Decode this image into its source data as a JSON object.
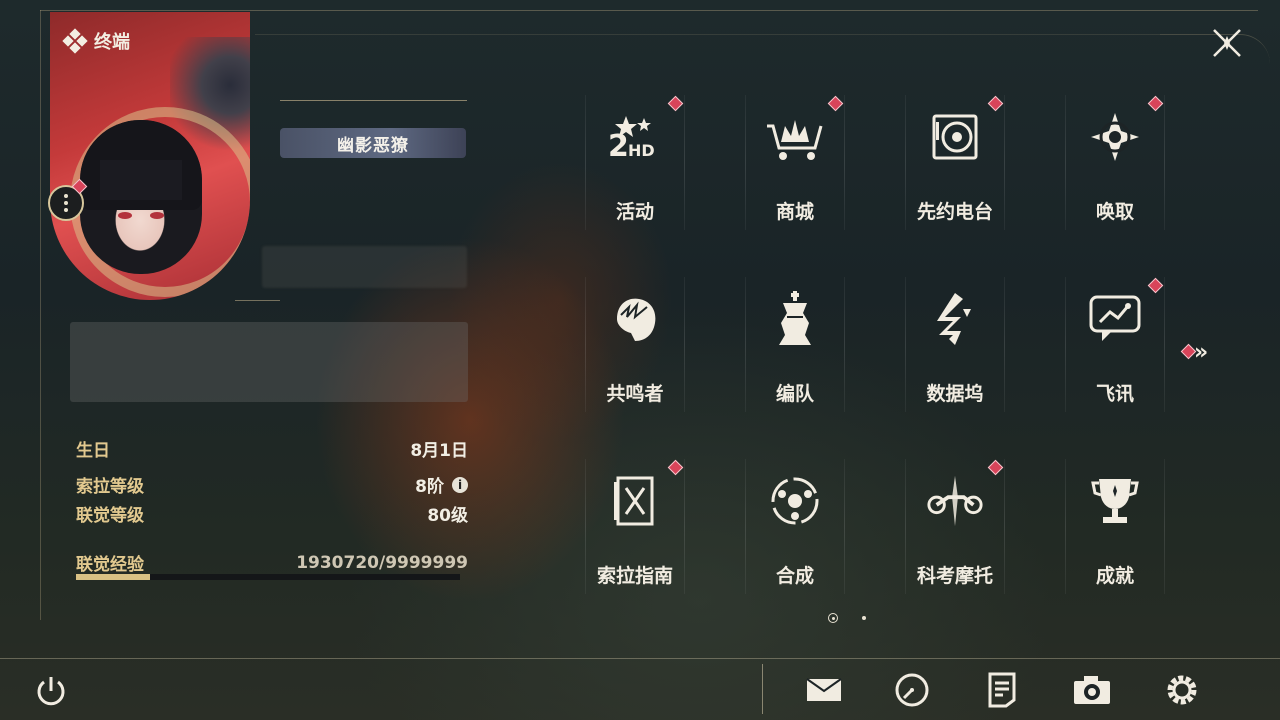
{
  "header": {
    "title": "终端",
    "close_icon": "close-x-icon"
  },
  "profile": {
    "player_name": "幽影恶獠",
    "avatar_menu_icon": "more-vertical-icon",
    "birthday_label": "生日",
    "birthday_value": "8月1日",
    "sola_level_label": "索拉等级",
    "sola_level_value": "8阶",
    "union_level_label": "联觉等级",
    "union_level_value": "80级",
    "union_exp_label": "联觉经验",
    "union_exp_value": "1930720/9999999",
    "union_exp_progress": 0.193
  },
  "menu": [
    {
      "label": "活动",
      "icon": "events-2hd-icon",
      "badge": true
    },
    {
      "label": "商城",
      "icon": "shop-cart-icon",
      "badge": true
    },
    {
      "label": "先约电台",
      "icon": "radio-record-icon",
      "badge": true
    },
    {
      "label": "唤取",
      "icon": "convene-star-icon",
      "badge": true
    },
    {
      "label": "共鸣者",
      "icon": "resonator-head-icon",
      "badge": false
    },
    {
      "label": "编队",
      "icon": "team-chess-icon",
      "badge": false
    },
    {
      "label": "数据坞",
      "icon": "data-bank-icon",
      "badge": false
    },
    {
      "label": "飞讯",
      "icon": "message-chat-icon",
      "badge": true
    },
    {
      "label": "索拉指南",
      "icon": "guidebook-icon",
      "badge": true
    },
    {
      "label": "合成",
      "icon": "synthesis-icon",
      "badge": false
    },
    {
      "label": "科考摩托",
      "icon": "motorbike-icon",
      "badge": true
    },
    {
      "label": "成就",
      "icon": "trophy-icon",
      "badge": false
    }
  ],
  "pager": {
    "next_icon": "double-chevron-right-icon",
    "pages": 2,
    "current": 1
  },
  "footer": {
    "power_icon": "power-icon",
    "icons": [
      "mail-icon",
      "clock-icon",
      "notes-icon",
      "camera-icon",
      "settings-gear-icon"
    ]
  },
  "colors": {
    "accent": "#d9c184",
    "badge": "#d8445a",
    "label": "#e2c98f"
  }
}
